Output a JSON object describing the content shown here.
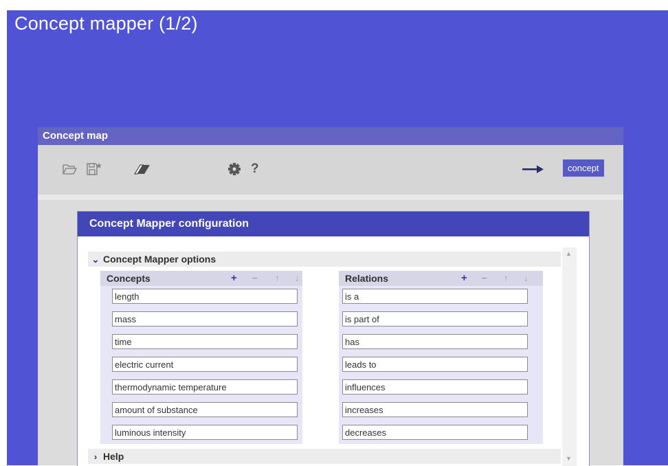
{
  "app": {
    "title": "Concept mapper (1/2)"
  },
  "concept_map": {
    "title": "Concept map",
    "toolbar": {
      "icons": [
        "open-folder-icon",
        "save-icon",
        "eraser-icon",
        "gear-icon",
        "help-icon",
        "arrow-right-icon"
      ],
      "help_glyph": "?",
      "concept_chip": "concept"
    }
  },
  "config_dialog": {
    "title": "Concept Mapper configuration",
    "options_section": "Concept Mapper options",
    "help_section": "Help",
    "concepts": {
      "header": "Concepts",
      "controls": [
        "+",
        "−",
        "↑",
        "↓"
      ],
      "items": [
        "length",
        "mass",
        "time",
        "electric current",
        "thermodynamic temperature",
        "amount of substance",
        "luminous intensity"
      ]
    },
    "relations": {
      "header": "Relations",
      "controls": [
        "+",
        "−",
        "↑",
        "↓"
      ],
      "items": [
        "is a",
        "is part of",
        "has",
        "leads to",
        "influences",
        "increases",
        "decreases"
      ]
    }
  },
  "colors": {
    "background": "#5053d3",
    "header_bar": "#6465c2",
    "dialog_title": "#4346b6",
    "accent_chip": "#5659c6"
  }
}
